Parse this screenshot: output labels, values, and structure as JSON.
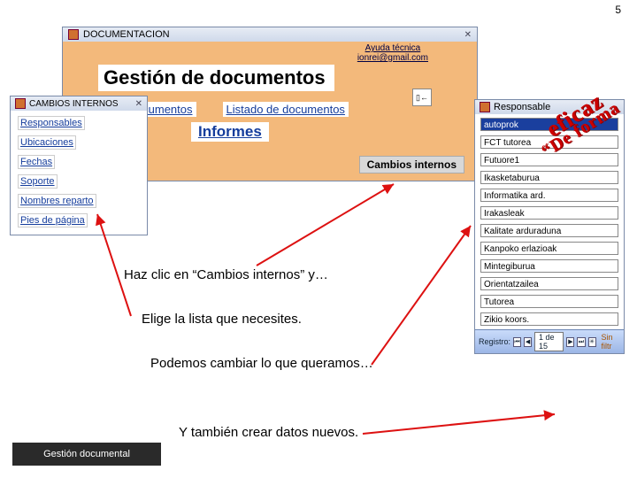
{
  "page_number": "5",
  "docwin": {
    "title": "DOCUMENTACION",
    "ayuda_line1": "Ayuda técnica",
    "ayuda_line2": "ionrei@gmail.com",
    "heading": "Gestión de documentos",
    "link_nuevos": "ros documentos",
    "link_listado": "Listado de documentos",
    "informes": "Informes",
    "cambios": "Cambios internos",
    "exit": "▯←"
  },
  "cambioswin": {
    "title": "CAMBIOS INTERNOS",
    "items": [
      "Responsables",
      "Ubicaciones",
      "Fechas",
      "Soporte",
      "Nombres reparto",
      "Pies de página"
    ]
  },
  "respwin": {
    "title": "Responsable",
    "fields": [
      "autoprok",
      "FCT tutorea",
      "Futuore1",
      "Ikasketaburua",
      "Informatika ard.",
      "Irakasleak",
      "Kalitate arduraduna",
      "Kanpoko erlazioak",
      "Mintegiburua",
      "Orientatzailea",
      "Tutorea",
      "Zikio koors."
    ],
    "nav_label": "Registro:",
    "nav_pos": "1 de 15",
    "nav_filter": "Sin filtr"
  },
  "instructions": {
    "i1": "Haz clic en “Cambios internos”  y…",
    "i2": "Elige la lista que necesites.",
    "i3": "Podemos cambiar lo que queramos…",
    "i4": "Y también crear datos nuevos."
  },
  "footer": "Gestión documental",
  "wordart": {
    "line1": "eficaz",
    "line2": "“De forma"
  }
}
